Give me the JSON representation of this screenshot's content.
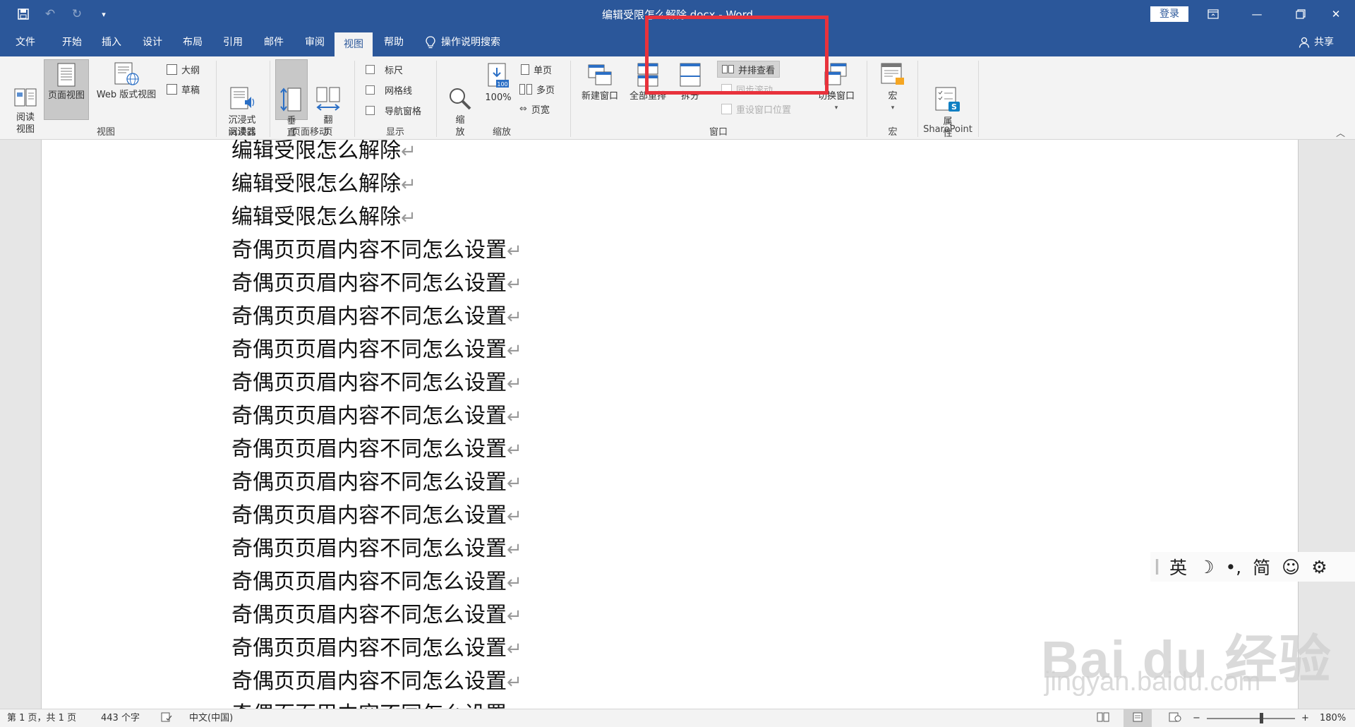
{
  "window": {
    "title": "编辑受限怎么解除.docx - Word",
    "login_label": "登录",
    "controls": [
      "ribbon-display",
      "minimize",
      "restore",
      "close"
    ]
  },
  "qat": {
    "save_icon": "save-icon",
    "undo_icon": "undo-icon",
    "redo_icon": "redo-icon",
    "customize_icon": "dropdown-icon"
  },
  "tabs": [
    {
      "label": "文件"
    },
    {
      "label": "开始"
    },
    {
      "label": "插入"
    },
    {
      "label": "设计"
    },
    {
      "label": "布局"
    },
    {
      "label": "引用"
    },
    {
      "label": "邮件"
    },
    {
      "label": "审阅"
    },
    {
      "label": "视图",
      "active": true
    },
    {
      "label": "帮助"
    }
  ],
  "tell_me": "操作说明搜索",
  "share": "共享",
  "ribbon": {
    "views": {
      "read_mode": "阅读\n视图",
      "print_layout": "页面视图",
      "web_layout": "Web 版式视图",
      "outline": "大纲",
      "draft": "草稿",
      "group": "视图"
    },
    "immersive": {
      "reader": "沉浸式\n阅读器",
      "group": "沉浸式"
    },
    "page_move": {
      "vertical": "垂\n直",
      "side_to_side": "翻\n页",
      "group": "页面移动"
    },
    "show": {
      "ruler": "标尺",
      "gridlines": "网格线",
      "nav_pane": "导航窗格",
      "group": "显示"
    },
    "zoom": {
      "zoom": "缩\n放",
      "percent": "100%",
      "one_page": "单页",
      "multi_page": "多页",
      "page_width": "页宽",
      "group": "缩放"
    },
    "window": {
      "new_window": "新建窗口",
      "arrange_all": "全部重排",
      "split": "拆分",
      "side_by_side": "并排查看",
      "sync_scroll": "同步滚动",
      "reset_position": "重设窗口位置",
      "switch_windows": "切换窗口",
      "group": "窗口"
    },
    "macros": {
      "macros": "宏",
      "group": "宏"
    },
    "sharepoint": {
      "properties": "属\n性",
      "group": "SharePoint"
    }
  },
  "document": {
    "lines": [
      "编辑受限怎么解除",
      "编辑受限怎么解除",
      "编辑受限怎么解除",
      "奇偶页页眉内容不同怎么设置",
      "奇偶页页眉内容不同怎么设置",
      "奇偶页页眉内容不同怎么设置",
      "奇偶页页眉内容不同怎么设置",
      "奇偶页页眉内容不同怎么设置",
      "奇偶页页眉内容不同怎么设置",
      "奇偶页页眉内容不同怎么设置",
      "奇偶页页眉内容不同怎么设置",
      "奇偶页页眉内容不同怎么设置",
      "奇偶页页眉内容不同怎么设置",
      "奇偶页页眉内容不同怎么设置",
      "奇偶页页眉内容不同怎么设置",
      "奇偶页页眉内容不同怎么设置",
      "奇偶页页眉内容不同怎么设置",
      "奇偶页页眉内容不同怎么设置"
    ],
    "paragraph_mark": "↵"
  },
  "ime": {
    "lang": "英",
    "moon": "☽",
    "punct": "•,",
    "simplified": "简",
    "emoji": "☺",
    "settings": "⚙"
  },
  "watermark": {
    "logo": "Bai du 经验",
    "url": "jingyan.baidu.com"
  },
  "status": {
    "page": "第 1 页，共 1 页",
    "words": "443 个字",
    "language": "中文(中国)",
    "zoom": "180%",
    "zoom_minus": "−",
    "zoom_plus": "+"
  },
  "colors": {
    "brand": "#2b579a",
    "highlight": "#e8323c"
  }
}
